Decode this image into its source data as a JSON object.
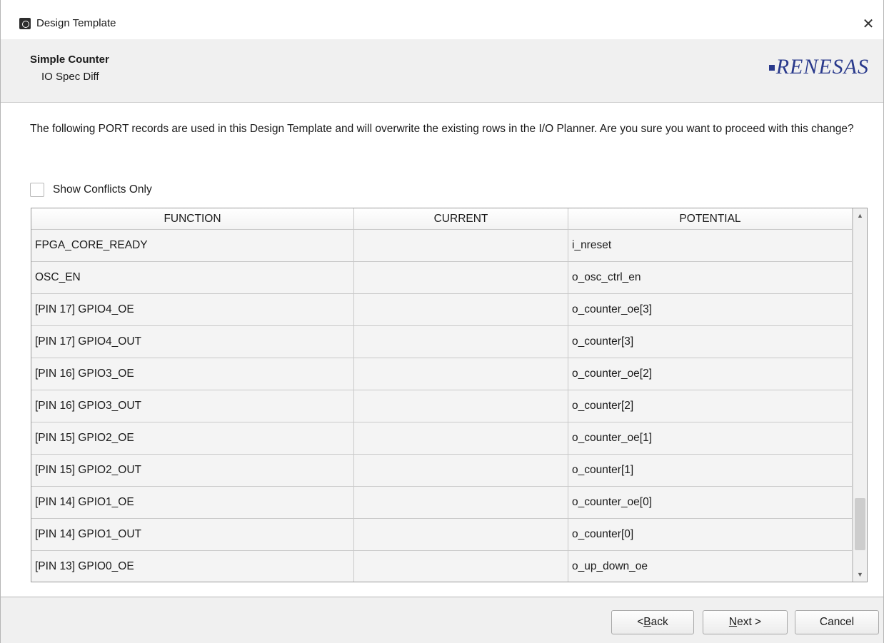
{
  "window": {
    "title": "Design Template",
    "close_glyph": "✕",
    "icon": "app-icon"
  },
  "header": {
    "title": "Simple Counter",
    "subtitle": "IO Spec Diff",
    "logo_text": "RENESAS",
    "logo_color": "#2a3a8c"
  },
  "message": "The following PORT records are used in this Design Template and will overwrite the existing rows in the I/O Planner. Are you sure you want to proceed with this change?",
  "filter": {
    "label": "Show Conflicts Only",
    "checked": false
  },
  "table": {
    "columns": [
      "FUNCTION",
      "CURRENT",
      "POTENTIAL"
    ],
    "rows": [
      {
        "function": "FPGA_CORE_READY",
        "current": "",
        "potential": "i_nreset"
      },
      {
        "function": "OSC_EN",
        "current": "",
        "potential": "o_osc_ctrl_en"
      },
      {
        "function": "[PIN 17] GPIO4_OE",
        "current": "",
        "potential": "o_counter_oe[3]"
      },
      {
        "function": "[PIN 17] GPIO4_OUT",
        "current": "",
        "potential": "o_counter[3]"
      },
      {
        "function": "[PIN 16] GPIO3_OE",
        "current": "",
        "potential": "o_counter_oe[2]"
      },
      {
        "function": "[PIN 16] GPIO3_OUT",
        "current": "",
        "potential": "o_counter[2]"
      },
      {
        "function": "[PIN 15] GPIO2_OE",
        "current": "",
        "potential": "o_counter_oe[1]"
      },
      {
        "function": "[PIN 15] GPIO2_OUT",
        "current": "",
        "potential": "o_counter[1]"
      },
      {
        "function": "[PIN 14] GPIO1_OE",
        "current": "",
        "potential": "o_counter_oe[0]"
      },
      {
        "function": "[PIN 14] GPIO1_OUT",
        "current": "",
        "potential": "o_counter[0]"
      },
      {
        "function": "[PIN 13] GPIO0_OE",
        "current": "",
        "potential": "o_up_down_oe"
      }
    ],
    "scroll": {
      "up_glyph": "▲",
      "down_glyph": "▼",
      "thumb_start_fraction": 0.8,
      "thumb_size_fraction": 0.15
    }
  },
  "buttons": {
    "back": {
      "prefix": "< ",
      "mnemonic": "B",
      "rest": "ack"
    },
    "next": {
      "prefix": "",
      "mnemonic": "N",
      "rest": "ext >"
    },
    "cancel": {
      "label": "Cancel"
    }
  }
}
